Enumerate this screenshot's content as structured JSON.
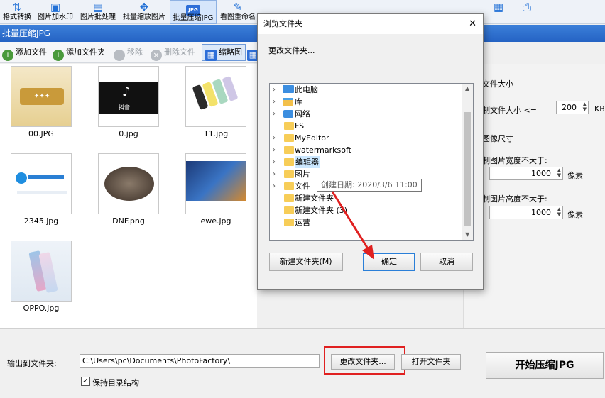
{
  "toolbar": {
    "items": [
      {
        "label": "格式转换",
        "icon": "convert-arrows-icon"
      },
      {
        "label": "图片加水印",
        "icon": "watermark-icon"
      },
      {
        "label": "图片批处理",
        "icon": "batch-image-icon"
      },
      {
        "label": "批量缩放图片",
        "icon": "resize-arrows-icon"
      },
      {
        "label": "批量压缩JPG",
        "icon": "jpg-icon",
        "active": true
      },
      {
        "label": "看图重命名",
        "icon": "rename-icon"
      },
      {
        "label": "",
        "icon": "grid-icon"
      },
      {
        "label": "",
        "icon": "printer-icon"
      }
    ]
  },
  "app": {
    "title": "批量压缩JPG"
  },
  "subtoolbar": {
    "add_file": "添加文件",
    "add_folder": "添加文件夹",
    "remove": "移除",
    "delete_file": "删除文件",
    "thumbnail": "缩略图"
  },
  "files": [
    {
      "name": "00.JPG"
    },
    {
      "name": "0.jpg"
    },
    {
      "name": "11.jpg"
    },
    {
      "name": "2345.jpg"
    },
    {
      "name": "DNF.png"
    },
    {
      "name": "ewe.jpg"
    },
    {
      "name": "OPPO.jpg"
    }
  ],
  "settings": {
    "file_size_title": "文件大小",
    "file_size_label": "制文件大小 <=",
    "file_size_value": "200",
    "file_size_unit": "KB",
    "image_size_title": "图像尺寸",
    "width_label": "制图片宽度不大于:",
    "width_value": "1000",
    "width_unit": "像素",
    "height_label": "制图片高度不大于:",
    "height_value": "1000",
    "height_unit": "像素"
  },
  "bottom": {
    "output_label": "输出到文件夹:",
    "output_path": "C:\\Users\\pc\\Documents\\PhotoFactory\\",
    "change_folder": "更改文件夹...",
    "open_folder": "打开文件夹",
    "keep_structure": "保持目录结构",
    "start": "开始压缩JPG"
  },
  "dialog": {
    "title": "浏览文件夹",
    "close": "✕",
    "prompt": "更改文件夹...",
    "tree": [
      {
        "label": "此电脑",
        "icon": "computer-icon",
        "expandable": true
      },
      {
        "label": "库",
        "icon": "library-icon",
        "expandable": true
      },
      {
        "label": "网络",
        "icon": "network-icon",
        "expandable": true
      },
      {
        "label": "FS",
        "icon": "folder-icon",
        "expandable": false
      },
      {
        "label": "MyEditor",
        "icon": "folder-icon",
        "expandable": true
      },
      {
        "label": "watermarksoft",
        "icon": "folder-icon",
        "expandable": true
      },
      {
        "label": "编辑器",
        "icon": "folder-icon",
        "expandable": true,
        "selected": true
      },
      {
        "label": "图片",
        "icon": "folder-icon",
        "expandable": true
      },
      {
        "label": "文件",
        "icon": "folder-icon",
        "expandable": true
      },
      {
        "label": "新建文件夹",
        "icon": "folder-icon",
        "expandable": false
      },
      {
        "label": "新建文件夹 (3)",
        "icon": "folder-icon",
        "expandable": false
      },
      {
        "label": "运营",
        "icon": "folder-icon",
        "expandable": false
      }
    ],
    "tooltip": "创建日期: 2020/3/6 11:00",
    "new_folder": "新建文件夹(M)",
    "ok": "确定",
    "cancel": "取消"
  },
  "colors": {
    "accent": "#2563c4",
    "highlight": "#e02020",
    "selection": "#cce8ff"
  }
}
